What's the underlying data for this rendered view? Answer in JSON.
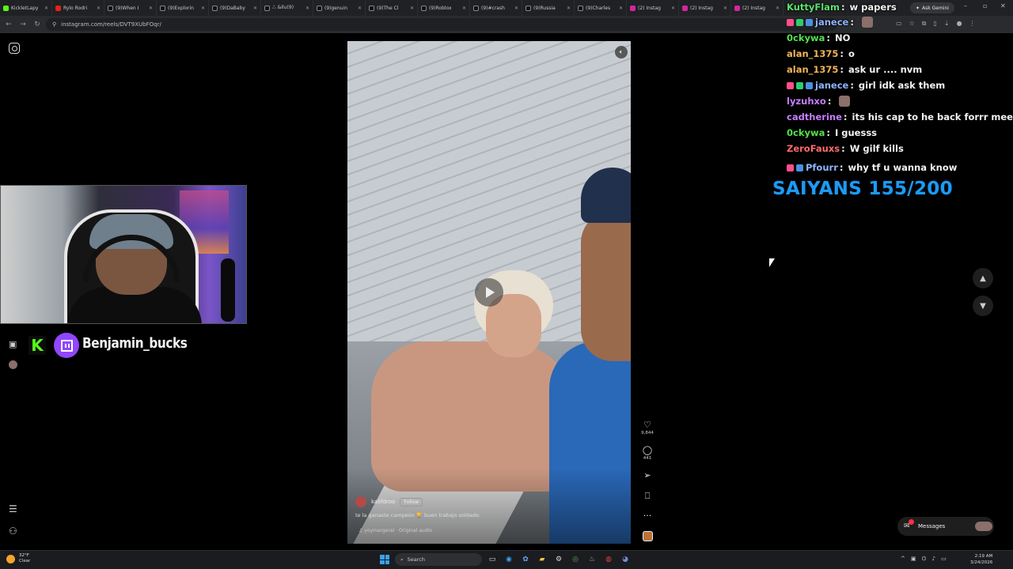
{
  "browser": {
    "tabs": [
      {
        "label": "KickletLapy",
        "icon": "kick"
      },
      {
        "label": "Rylo Rodri",
        "icon": "youtube"
      },
      {
        "label": "(9)When I",
        "icon": "tiktok"
      },
      {
        "label": "(9)Explorin",
        "icon": "tiktok"
      },
      {
        "label": "(9)DaBaby",
        "icon": "tiktok"
      },
      {
        "label": "ஃ &Ilu(9)",
        "icon": "tiktok"
      },
      {
        "label": "(9)genuin",
        "icon": "tiktok"
      },
      {
        "label": "(9)The Cl",
        "icon": "tiktok"
      },
      {
        "label": "(9)Roblox",
        "icon": "tiktok"
      },
      {
        "label": "(9)#crash",
        "icon": "tiktok"
      },
      {
        "label": "(9)Russia",
        "icon": "tiktok"
      },
      {
        "label": "(9)Charles",
        "icon": "tiktok"
      },
      {
        "label": "(2) Instag",
        "icon": "instagram"
      },
      {
        "label": "(2) Instag",
        "icon": "instagram"
      },
      {
        "label": "(2) Instag",
        "icon": "instagram"
      }
    ],
    "ask_gemini": "Ask Gemini",
    "url": "instagram.com/reels/DVT9XUbFOqr/"
  },
  "stream": {
    "streamer_name": "Benjamin_bucks",
    "kick_letter": "K"
  },
  "reel": {
    "username": "kalifdroo",
    "follow_label": "Follow",
    "caption": "te la ganaste campeón 🏆 buen trabajo soldado.",
    "audio": "♫ yoymargeral · Original audio",
    "likes": "9,844",
    "comments": "441"
  },
  "chat": {
    "messages": [
      {
        "user": "KuttyFlam",
        "text": "w papers",
        "color": "#5be36b",
        "badges": [],
        "emote": false
      },
      {
        "user": "janece",
        "text": "",
        "color": "#8fb4ff",
        "badges": [
          "#ff4f8b",
          "#2ecc71",
          "#4a90e2"
        ],
        "emote": true
      },
      {
        "user": "0ckywa",
        "text": "NO",
        "color": "#53e04a",
        "badges": [],
        "emote": false
      },
      {
        "user": "alan_1375",
        "text": "o",
        "color": "#f2b35a",
        "badges": [],
        "emote": false
      },
      {
        "user": "alan_1375",
        "text": "ask ur .... nvm",
        "color": "#f2b35a",
        "badges": [],
        "emote": false
      },
      {
        "user": "janece",
        "text": "girl idk ask them",
        "color": "#8fb4ff",
        "badges": [
          "#ff4f8b",
          "#2ecc71",
          "#4a90e2"
        ],
        "emote": false
      },
      {
        "user": "lyzuhxo",
        "text": "",
        "color": "#c77dff",
        "badges": [],
        "emote": true
      },
      {
        "user": "cadtherine",
        "text": "its his cap to he back forrr meee",
        "color": "#c77dff",
        "badges": [],
        "emote": false
      },
      {
        "user": "0ckywa",
        "text": "I guesss",
        "color": "#53e04a",
        "badges": [],
        "emote": false
      },
      {
        "user": "ZeroFauxs",
        "text": "W gilf kills",
        "color": "#ff6b6b",
        "badges": [],
        "emote": false
      },
      {
        "user": "Pfourr",
        "text": "why tf u wanna know",
        "color": "#8fb4ff",
        "badges": [
          "#ff4f8b",
          "#4a90e2"
        ],
        "emote": false
      }
    ]
  },
  "counter": "SAIYANS 155/200",
  "messages_pill": "Messages",
  "taskbar": {
    "weather_temp": "32°F",
    "weather_desc": "Clear",
    "search_placeholder": "Search",
    "time": "2:19 AM",
    "date": "3/24/2026"
  }
}
